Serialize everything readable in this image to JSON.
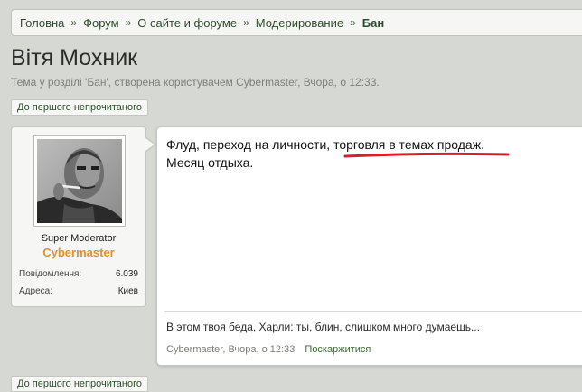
{
  "breadcrumb": {
    "items": [
      "Головна",
      "Форум",
      "О сайте и форуме",
      "Модерирование"
    ],
    "separator": "»",
    "current": "Бан"
  },
  "thread": {
    "title": "Вітя Мохник",
    "subtitle": "Тема у розділі 'Бан', створена користувачем Cybermaster, Вчора, о 12:33."
  },
  "buttons": {
    "first_unread_top": "До першого непрочитаного",
    "first_unread_bottom": "До першого непрочитаного"
  },
  "user": {
    "role": "Super Moderator",
    "name": "Cybermaster",
    "name_color": "#e3922a",
    "stats": [
      {
        "label": "Повідомлення:",
        "value": "6.039"
      },
      {
        "label": "Адреса:",
        "value": "Киев"
      }
    ]
  },
  "post": {
    "line1_plain": "Флуд, переход на личности, ",
    "line1_highlight": "торговля в темах продаж",
    "line1_end": ".",
    "line2": "Месяц отдыха.",
    "highlight_color": "#d1202a",
    "signature": "В этом твоя беда, Харли: ты, блин, слишком много думаешь...",
    "meta": "Cybermaster, Вчора, о 12:33",
    "report_label": "Поскаржитися"
  }
}
